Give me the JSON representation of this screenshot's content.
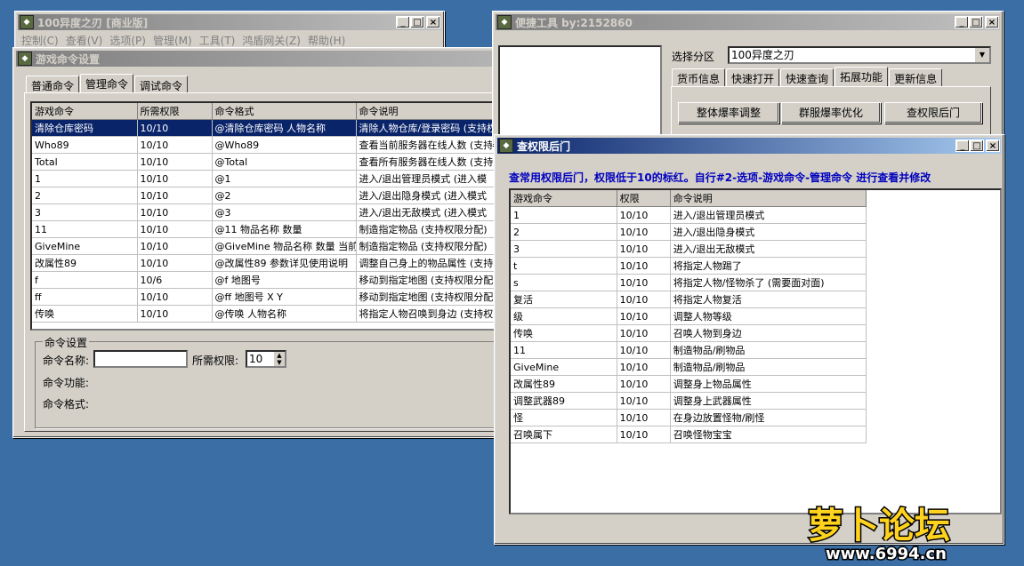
{
  "win_main": {
    "title": "100异度之刃 [商业版]",
    "menu": [
      "控制(C)",
      "查看(V)",
      "选项(P)",
      "管理(M)",
      "工具(T)",
      "鸿盾网关(Z)",
      "帮助(H)"
    ]
  },
  "win_cmd": {
    "title": "游戏命令设置",
    "tabs": [
      "普通命令",
      "管理命令",
      "调试命令"
    ],
    "columns": [
      "游戏命令",
      "所需权限",
      "命令格式",
      "命令说明"
    ],
    "rows": [
      [
        "清除仓库密码",
        "10/10",
        "@清除仓库密码 人物名称",
        "清除人物仓库/登录密码 (支持权限分配)"
      ],
      [
        "Who89",
        "10/10",
        "@Who89",
        "查看当前服务器在线人数 (支持"
      ],
      [
        "Total",
        "10/10",
        "@Total",
        "查看所有服务器在线人数 (支持"
      ],
      [
        "1",
        "10/10",
        "@1",
        "进入/退出管理员模式 (进入模"
      ],
      [
        "2",
        "10/10",
        "@2",
        "进入/退出隐身模式 (进入模式"
      ],
      [
        "3",
        "10/10",
        "@3",
        "进入/退出无敌模式 (进入模式"
      ],
      [
        "11",
        "10/10",
        "@11 物品名称 数量",
        "制造指定物品 (支持权限分配)"
      ],
      [
        "GiveMine",
        "10/10",
        "@GiveMine 物品名称 数量 当前",
        "制造指定物品 (支持权限分配)"
      ],
      [
        "改属性89",
        "10/10",
        "@改属性89 参数详见使用说明",
        "调整自己身上的物品属性 (支持"
      ],
      [
        "f",
        "10/6",
        "@f 地图号",
        "移动到指定地图 (支持权限分配"
      ],
      [
        "ff",
        "10/10",
        "@ff 地图号 X Y",
        "移动到指定地图 (支持权限分配"
      ],
      [
        "传唤",
        "10/10",
        "@传唤 人物名称",
        "将指定人物召唤到身边 (支持权"
      ]
    ],
    "group_title": "命令设置",
    "name_label": "命令名称:",
    "name_value": "",
    "perm_label": "所需权限:",
    "perm_value": "10",
    "func_label": "命令功能:",
    "format_label": "命令格式:"
  },
  "win_tools": {
    "title": "便捷工具   by:2152860",
    "zone_label": "选择分区",
    "zone_value": "100异度之刃",
    "tabs": [
      "货币信息",
      "快速打开",
      "快速查询",
      "拓展功能",
      "更新信息"
    ],
    "buttons": [
      "整体爆率调整",
      "群服爆率优化",
      "查权限后门"
    ]
  },
  "win_perm": {
    "title": "查权限后门",
    "notice": "查常用权限后门，权限低于10的标红。自行#2-选项-游戏命令-管理命令 进行查看并修改",
    "columns": [
      "游戏命令",
      "权限",
      "命令说明"
    ],
    "rows": [
      [
        "1",
        "10/10",
        "进入/退出管理员模式"
      ],
      [
        "2",
        "10/10",
        "进入/退出隐身模式"
      ],
      [
        "3",
        "10/10",
        "进入/退出无敌模式"
      ],
      [
        "t",
        "10/10",
        "将指定人物踢了"
      ],
      [
        "s",
        "10/10",
        "将指定人物/怪物杀了 (需要面对面)"
      ],
      [
        "复活",
        "10/10",
        "将指定人物复活"
      ],
      [
        "级",
        "10/10",
        "调整人物等级"
      ],
      [
        "传唤",
        "10/10",
        "召唤人物到身边"
      ],
      [
        "11",
        "10/10",
        "制造物品/刷物品"
      ],
      [
        "GiveMine",
        "10/10",
        "制造物品/刷物品"
      ],
      [
        "改属性89",
        "10/10",
        "调整身上物品属性"
      ],
      [
        "调整武器89",
        "10/10",
        "调整身上武器属性"
      ],
      [
        "怪",
        "10/10",
        "在身边放置怪物/刷怪"
      ],
      [
        "召唤属下",
        "10/10",
        "召唤怪物宝宝"
      ]
    ]
  },
  "watermark": {
    "text": "萝卜论坛",
    "url": "www.6994.cn"
  }
}
